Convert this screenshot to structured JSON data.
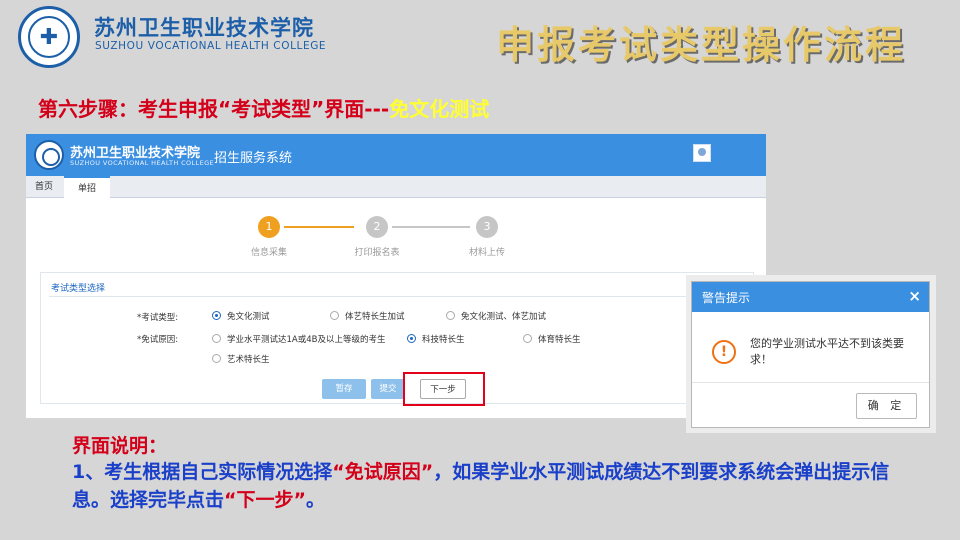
{
  "slide": {
    "college_cn": "苏州卫生职业技术学院",
    "college_en": "SUZHOU VOCATIONAL HEALTH COLLEGE",
    "title": "申报考试类型操作流程",
    "step_heading_prefix": "第六步骤：考生申报“考试类型”界面---",
    "step_heading_highlight": "免文化测试"
  },
  "app": {
    "college_cn": "苏州卫生职业技术学院",
    "college_en": "SUZHOU VOCATIONAL HEALTH COLLEGE",
    "system_name": "招生服务系统",
    "tabs": [
      "首页",
      "单招"
    ],
    "steps": [
      {
        "num": "1",
        "label": "信息采集",
        "state": "active"
      },
      {
        "num": "2",
        "label": "打印报名表",
        "state": "pending"
      },
      {
        "num": "3",
        "label": "材料上传",
        "state": "pending"
      }
    ],
    "form": {
      "section_title": "考试类型选择",
      "exam_type_label": "*考试类型:",
      "exam_type_options": [
        "免文化测试",
        "体艺特长生加试",
        "免文化测试、体艺加试"
      ],
      "exam_type_selected": "免文化测试",
      "exempt_reason_label": "*免试原因:",
      "exempt_reason_options": [
        "学业水平测试达1A或4B及以上等级的考生",
        "科技特长生",
        "体育特长生",
        "艺术特长生"
      ],
      "exempt_reason_selected": "科技特长生",
      "btn_save": "暂存",
      "btn_submit": "提交",
      "btn_next": "下一步"
    }
  },
  "dialog": {
    "title": "警告提示",
    "close": "×",
    "icon": "warning-icon",
    "message": "您的学业测试水平达不到该类要求！",
    "ok": "确 定"
  },
  "explain": {
    "title": "界面说明：",
    "p1": "1、考生根据自己实际情况选择",
    "q1": "“免试原因”",
    "p2": "，如果学业水平测试成绩达不到要求系统会弹出提示信息。选择完毕点击",
    "q2": "“下一步”",
    "p3": "。"
  },
  "colors": {
    "accent_blue": "#3b8fe0",
    "step_active": "#f0a020",
    "heading_red": "#d4001a",
    "body_blue": "#1a3fc9"
  }
}
